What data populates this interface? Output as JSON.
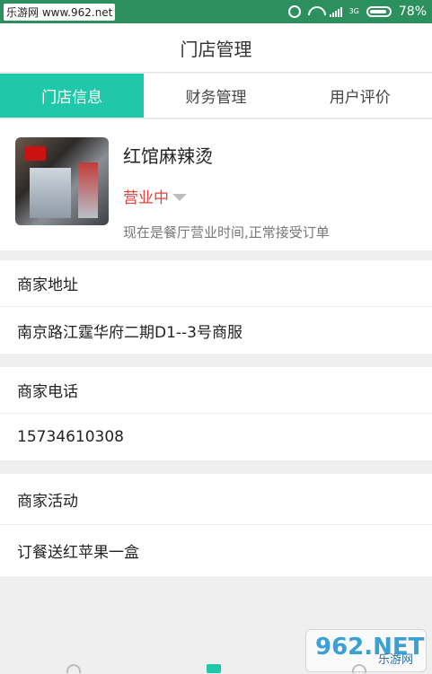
{
  "status_bar": {
    "watermark": "乐游网 www.962.net",
    "network": "3G",
    "battery": "78%"
  },
  "header": {
    "title": "门店管理"
  },
  "tabs": [
    {
      "label": "门店信息",
      "active": true
    },
    {
      "label": "财务管理",
      "active": false
    },
    {
      "label": "用户评价",
      "active": false
    }
  ],
  "shop": {
    "name": "红馆麻辣烫",
    "status": "营业中",
    "description": "现在是餐厅营业时间,正常接受订单"
  },
  "sections": {
    "address": {
      "title": "商家地址",
      "value": "南京路江霆华府二期D1--3号商服"
    },
    "phone": {
      "title": "商家电话",
      "value": "15734610308"
    },
    "activity": {
      "title": "商家活动",
      "value": "订餐送红苹果一盒"
    }
  },
  "watermark": {
    "logo": "962.NET",
    "sub": "乐游网"
  },
  "colors": {
    "accent": "#1ec8a8",
    "status_red": "#e5413b"
  }
}
